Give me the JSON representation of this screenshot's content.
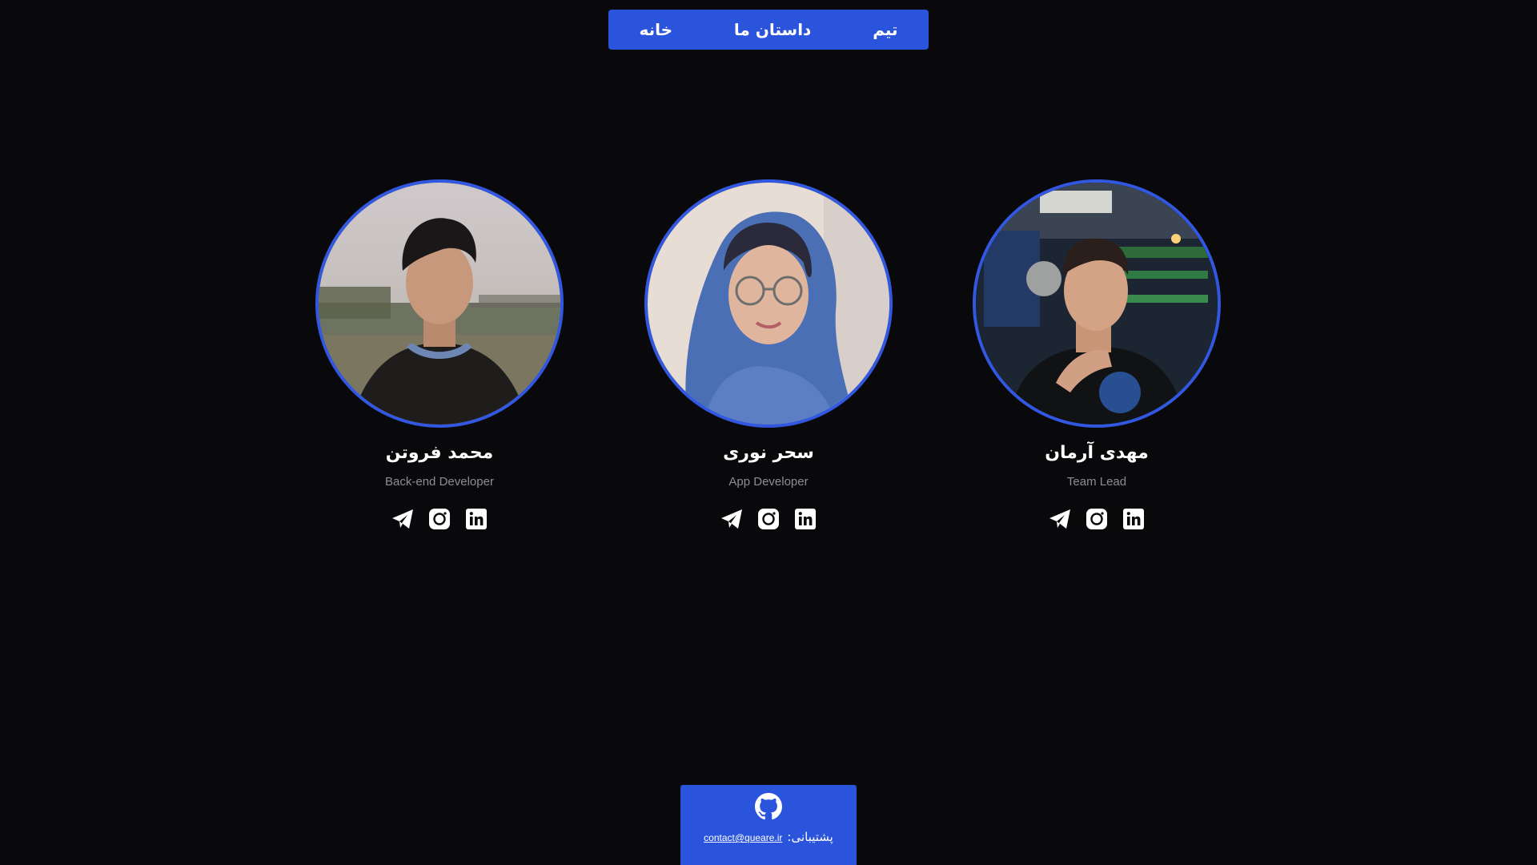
{
  "nav": {
    "items": [
      {
        "label": "خانه"
      },
      {
        "label": "داستان ما"
      },
      {
        "label": "تیم"
      }
    ]
  },
  "team": {
    "members": [
      {
        "name": "مهدی آرمان",
        "role": "Team Lead",
        "photo": "man-smiling-hand-on-chin-photo"
      },
      {
        "name": "سحر نوری",
        "role": "App Developer",
        "photo": "woman-with-glasses-blue-scarf-photo"
      },
      {
        "name": "محمد فروتن",
        "role": "Back-end Developer",
        "photo": "man-dark-hair-bridge-background-photo"
      }
    ],
    "social_icons": [
      "telegram-icon",
      "instagram-icon",
      "linkedin-icon"
    ]
  },
  "footer": {
    "icon": "github-icon",
    "support_label": "پشتیبانی:",
    "email": "contact@queare.ir"
  },
  "colors": {
    "background": "#09090b",
    "accent": "#2b54dc",
    "ring": "#3257e0",
    "muted_text": "#8d8d93"
  }
}
